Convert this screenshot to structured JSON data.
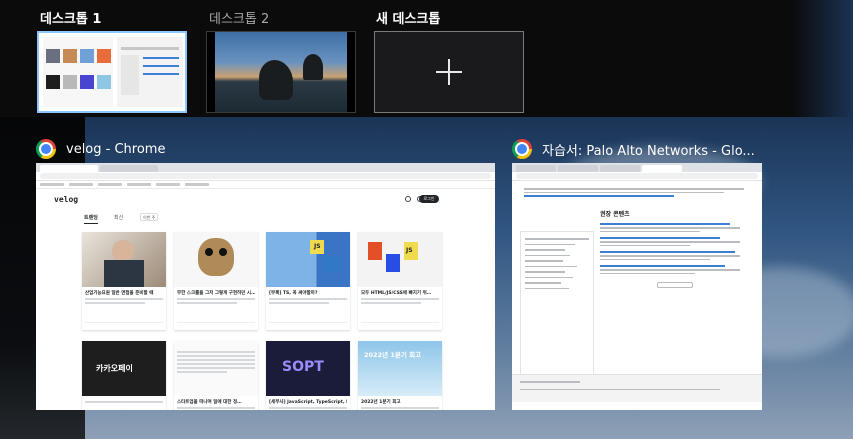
{
  "desktops": [
    {
      "label": "데스크톱 1",
      "active": true
    },
    {
      "label": "데스크톱 2",
      "active": false
    }
  ],
  "new_desktop": {
    "label": "새 데스크톱",
    "icon": "plus-icon"
  },
  "windows": [
    {
      "title": "velog - Chrome",
      "icon": "chrome-icon",
      "page": {
        "logo": "velog",
        "login_label": "로그인",
        "tab_trending": "트렌딩",
        "tab_recent": "최신",
        "period_select": "이번 주",
        "cards": [
          {
            "title": "산업기능요원 일반 면접을 준비할 때",
            "thumb_text": ""
          },
          {
            "title": "무한 스크롤을 그저 그렇게 구현하던 시…",
            "thumb_text": ""
          },
          {
            "title": "[부록] TS, 꼭 써야할까?",
            "thumb_text": "JS"
          },
          {
            "title": "모두 HTML/JS/CSS에 빠지기 위…",
            "thumb_text": "JS"
          },
          {
            "title": "",
            "thumb_text": "카카오페이"
          },
          {
            "title": "스타트업을 떠나며 일에 대한 정…",
            "thumb_text": ""
          },
          {
            "title": "[세부사] JavaScript, TypeScript, Nod…",
            "thumb_text": "SOPT"
          },
          {
            "title": "2022년 1분기 회고",
            "thumb_text": "2022년 1분기 회고"
          }
        ]
      }
    },
    {
      "title": "자습서: Palo Alto Networks - Glo...",
      "icon": "chrome-icon",
      "page": {
        "section_heading": "권장 콘텐츠"
      }
    }
  ],
  "colors": {
    "active_border": "#8fc6ff",
    "strip_bg": "#0b0b0c"
  }
}
